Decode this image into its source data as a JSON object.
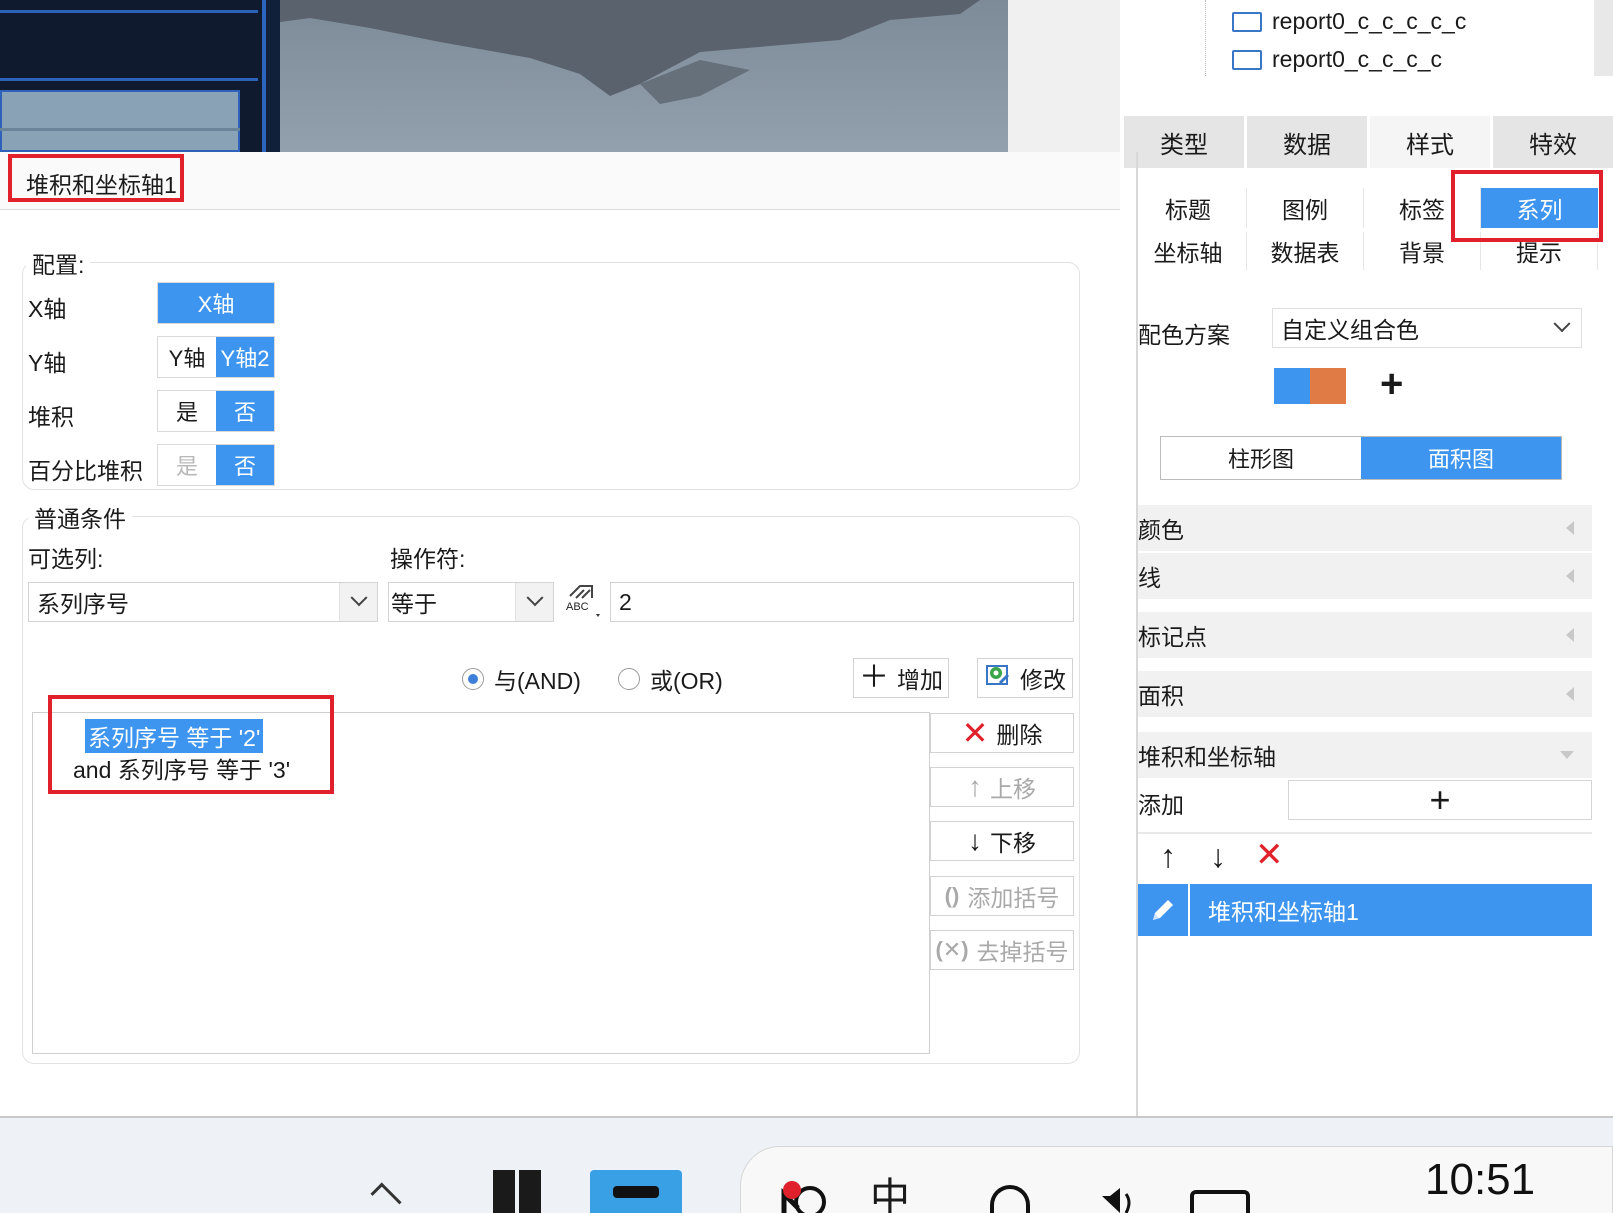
{
  "dialog": {
    "title": "堆积和坐标轴1",
    "config": {
      "legend": "配置:",
      "x_axis_label": "X轴",
      "x_axis_option": "X轴",
      "y_axis_label": "Y轴",
      "y_axis_options": [
        "Y轴",
        "Y轴2"
      ],
      "y_axis_selected": "Y轴2",
      "stack_label": "堆积",
      "stack_options": [
        "是",
        "否"
      ],
      "stack_selected": "否",
      "percent_stack_label": "百分比堆积",
      "percent_stack_options": [
        "是",
        "否"
      ],
      "percent_stack_selected": "否"
    },
    "condition": {
      "legend": "普通条件",
      "column_label": "可选列:",
      "column_value": "系列序号",
      "operator_label": "操作符:",
      "operator_value": "等于",
      "value_icon": "abc-formula-icon",
      "value": "2",
      "and_label": "与(AND)",
      "or_label": "或(OR)",
      "logic_selected": "AND",
      "add_button": "增加",
      "modify_button": "修改",
      "conditions": [
        "系列序号 等于 '2'",
        "and 系列序号 等于 '3'"
      ],
      "delete_button": "删除",
      "move_up_button": "上移",
      "move_down_button": "下移",
      "add_paren_button": "添加括号",
      "remove_paren_button": "去掉括号"
    }
  },
  "right_panel": {
    "tree_items": [
      "report0_c_c_c_c_c",
      "report0_c_c_c_c"
    ],
    "tabs": [
      "类型",
      "数据",
      "样式",
      "特效"
    ],
    "active_tab": "样式",
    "subtabs_row1": [
      "标题",
      "图例",
      "标签",
      "系列"
    ],
    "subtabs_row2": [
      "坐标轴",
      "数据表",
      "背景",
      "提示"
    ],
    "active_subtab": "系列",
    "color_scheme_label": "配色方案",
    "color_scheme_value": "自定义组合色",
    "swatches": [
      "#3d95ef",
      "#e07b45"
    ],
    "chart_types": [
      "柱形图",
      "面积图"
    ],
    "chart_type_selected": "面积图",
    "sections": [
      "颜色",
      "线",
      "标记点",
      "面积"
    ],
    "stack_section": "堆积和坐标轴",
    "add_label": "添加",
    "list_item": "堆积和坐标轴1"
  },
  "taskbar": {
    "time": "10:51",
    "ime_label": "中"
  }
}
